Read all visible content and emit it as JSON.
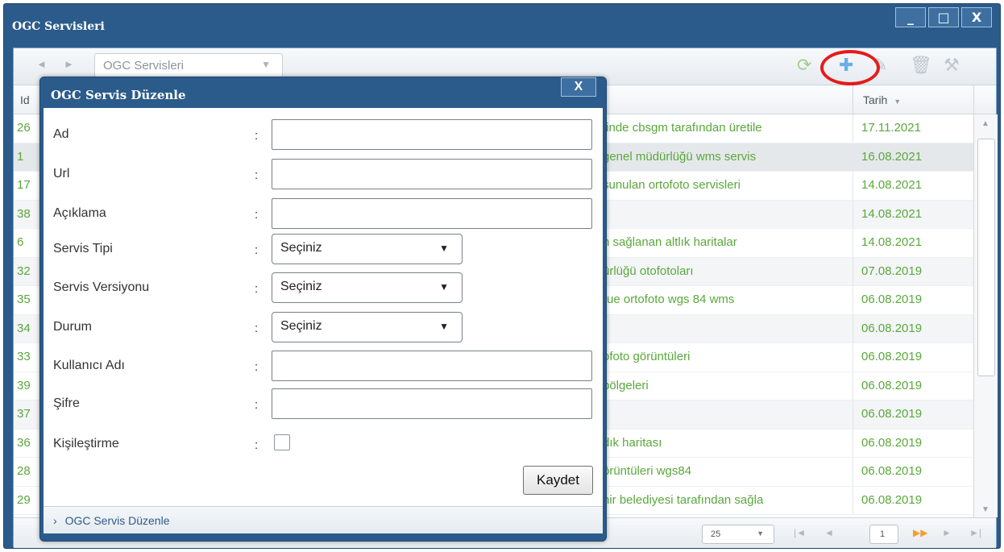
{
  "window": {
    "title": "OGC Servisleri",
    "controls": [
      "_",
      "□",
      "X"
    ]
  },
  "toolbar": {
    "back": "◄",
    "forward": "►",
    "combo_value": "OGC Servisleri",
    "icons": [
      "refresh-icon",
      "add-icon",
      "edit-icon",
      "delete-icon",
      "tools-icon"
    ]
  },
  "grid": {
    "col_id": "Id",
    "col_tarih": "Tarih",
    "rows": [
      {
        "id": "26",
        "desc": "tinde cbsgm tarafından üretile",
        "tarih": "17.11.2021"
      },
      {
        "id": "1",
        "desc": "genel müdürlüğü wms servis",
        "tarih": "16.08.2021"
      },
      {
        "id": "17",
        "desc": "sunulan ortofoto servisleri",
        "tarih": "14.08.2021"
      },
      {
        "id": "38",
        "desc": "",
        "tarih": "14.08.2021"
      },
      {
        "id": "6",
        "desc": "n sağlanan altlık haritalar",
        "tarih": "14.08.2021"
      },
      {
        "id": "32",
        "desc": "ürlüğü otofotoları",
        "tarih": "07.08.2019"
      },
      {
        "id": "35",
        "desc": "rue ortofoto wgs 84 wms",
        "tarih": "06.08.2019"
      },
      {
        "id": "34",
        "desc": "",
        "tarih": "06.08.2019"
      },
      {
        "id": "33",
        "desc": "ofoto görüntüleri",
        "tarih": "06.08.2019"
      },
      {
        "id": "39",
        "desc": "bölgeleri",
        "tarih": "06.08.2019"
      },
      {
        "id": "37",
        "desc": "",
        "tarih": "06.08.2019"
      },
      {
        "id": "36",
        "desc": "dık haritası",
        "tarih": "06.08.2019"
      },
      {
        "id": "28",
        "desc": "örüntüleri wgs84",
        "tarih": "06.08.2019"
      },
      {
        "id": "29",
        "desc": "hir belediyesi tarafından sağla",
        "tarih": "06.08.2019"
      }
    ]
  },
  "paging": {
    "page_size": "25",
    "page": "1"
  },
  "dialog": {
    "title": "OGC Servis Düzenle",
    "close": "X",
    "fields": {
      "ad": "Ad",
      "url": "Url",
      "aciklama": "Açıklama",
      "servis_tipi": "Servis Tipi",
      "servis_versiyonu": "Servis Versiyonu",
      "durum": "Durum",
      "kullanici_adi": "Kullanıcı Adı",
      "sifre": "Şifre",
      "kisilestirme": "Kişileştirme"
    },
    "colon": ":",
    "select_placeholder": "Seçiniz",
    "save": "Kaydet",
    "footer": "OGC Servis Düzenle"
  },
  "colors": {
    "window_blue": "#2b5b8a",
    "row_text_green": "#5aa83c",
    "highlight_red": "#e41b1b"
  }
}
